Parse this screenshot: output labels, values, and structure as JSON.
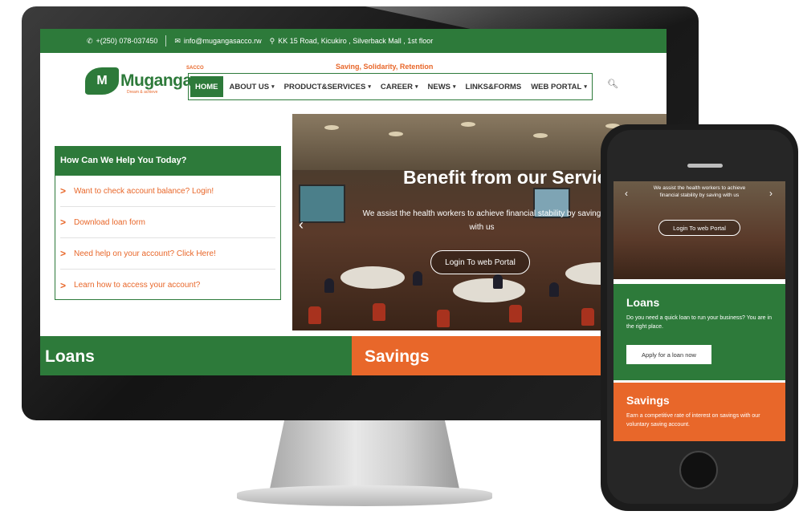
{
  "topbar": {
    "phone": "+(250) 078-037450",
    "email": "info@mugangasacco.rw",
    "address": "KK 15 Road, Kicukiro , Silverback Mall , 1st floor"
  },
  "brand": {
    "logo_text": "Muganga",
    "logo_sacco": "SACCO",
    "logo_tagline": "Dream & achieve",
    "tagline": "Saving, Solidarity, Retention",
    "green": "#2d7a3a",
    "orange": "#e8672a"
  },
  "nav": {
    "items": [
      {
        "label": "HOME"
      },
      {
        "label": "ABOUT US"
      },
      {
        "label": "PRODUCT&SERVICES"
      },
      {
        "label": "CAREER"
      },
      {
        "label": "NEWS"
      },
      {
        "label": "LINKS&FORMS"
      },
      {
        "label": "WEB PORTAL"
      }
    ],
    "search_icon": "magnifier-icon"
  },
  "help": {
    "title": "How Can We Help You Today?",
    "items": [
      {
        "label": "Want to check account balance? Login!"
      },
      {
        "label": "Download loan form"
      },
      {
        "label": "Need help on your account? Click Here!"
      },
      {
        "label": "Learn how to access your account?"
      }
    ]
  },
  "hero": {
    "title": "Benefit from our Services",
    "text": "We assist the health workers to achieve financial stability by saving with us",
    "button": "Login To web Portal"
  },
  "sections": {
    "loans": "Loans",
    "savings": "Savings"
  },
  "mobile": {
    "hero_text": "We assist the health workers to achieve financial stability by saving with us",
    "hero_button": "Login To web Portal",
    "loans_title": "Loans",
    "loans_text": "Do you need a quick loan to run your business? You are in the right place.",
    "loans_button": "Apply for a loan now",
    "savings_title": "Savings",
    "savings_text": "Earn a competitive rate of interest on savings with our voluntary saving account."
  }
}
